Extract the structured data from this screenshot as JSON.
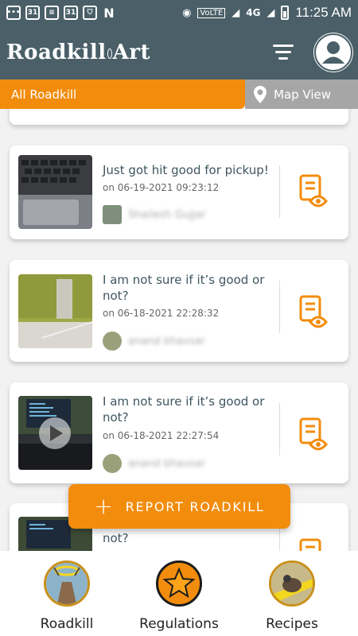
{
  "status_bar": {
    "time": "11:25 AM",
    "network": "4G",
    "volte": "VoLTE"
  },
  "app_bar": {
    "logo_text": "Roadkill",
    "logo_text2": "Art"
  },
  "tabs": {
    "all_label": "All Roadkill",
    "map_label": "Map View"
  },
  "posts": [
    {
      "title": "Just got hit good for pickup!",
      "date": "on 06-19-2021 09:23:12",
      "user": "Shailesh Gujjar"
    },
    {
      "title": "I am not sure if it’s good or not?",
      "date": "on 06-18-2021 22:28:32",
      "user": "anand bhavsar"
    },
    {
      "title": "I am not sure if it’s good or not?",
      "date": "on 06-18-2021 22:27:54",
      "user": "anand bhavsar"
    },
    {
      "title": "not?"
    }
  ],
  "report_button": {
    "label": "REPORT ROADKILL"
  },
  "bottom_nav": [
    {
      "label": "Roadkill"
    },
    {
      "label": "Regulations"
    },
    {
      "label": "Recipes"
    }
  ],
  "colors": {
    "header": "#4a5f68",
    "accent": "#f28c0d",
    "map_tab": "#a6a6a6"
  }
}
